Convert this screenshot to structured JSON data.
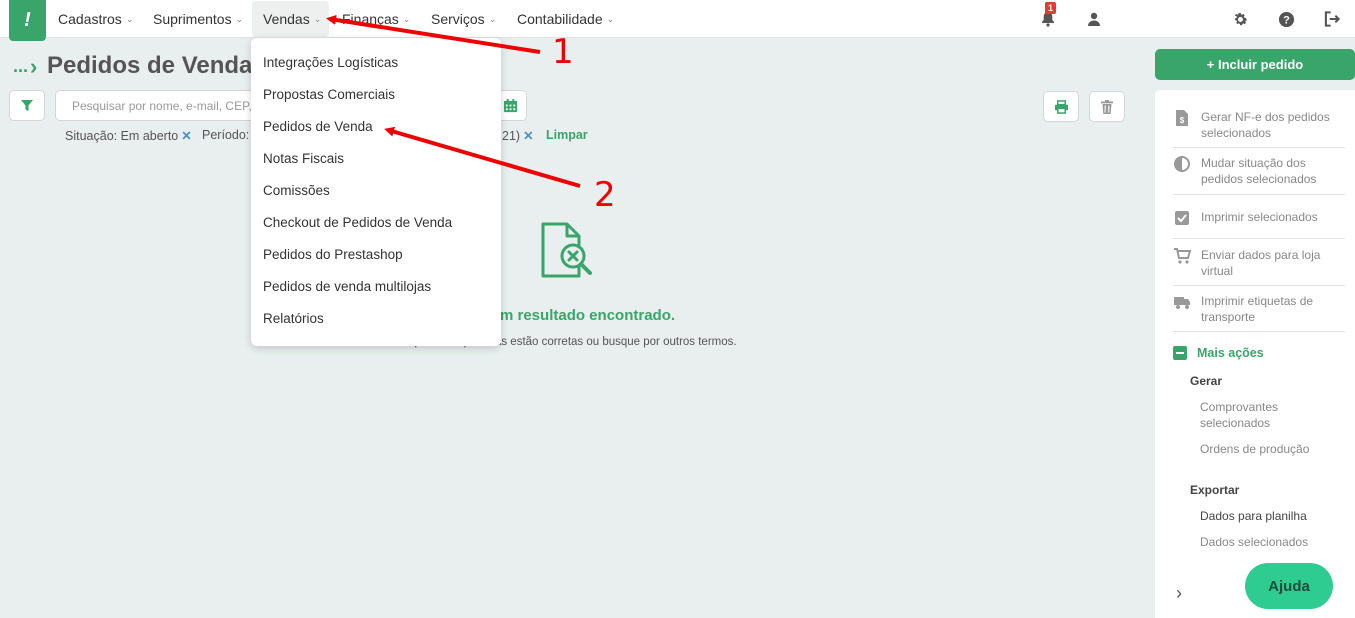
{
  "topbar": {
    "nav": [
      {
        "label": "Cadastros"
      },
      {
        "label": "Suprimentos"
      },
      {
        "label": "Vendas"
      },
      {
        "label": "Finanças"
      },
      {
        "label": "Serviços"
      },
      {
        "label": "Contabilidade"
      }
    ],
    "notification_count": "1",
    "icons": [
      "bell-icon",
      "user-icon",
      "gear-icon",
      "help-icon",
      "logout-icon"
    ]
  },
  "breadcrumb": {
    "ellipsis": "...",
    "title": "Pedidos de Venda"
  },
  "search": {
    "placeholder": "Pesquisar por nome, e-mail, CEP,"
  },
  "filters": {
    "situacao": "Situação: Em aberto",
    "periodo_label": "Período:",
    "periodo_tail": "21)",
    "clear": "Limpar"
  },
  "empty_state": {
    "title": "m resultado encontrado.",
    "subtitle": "Verifique se as palavras estão corretas ou busque por outros termos."
  },
  "dropdown": {
    "items": [
      "Integrações Logísticas",
      "Propostas Comerciais",
      "Pedidos de Venda",
      "Notas Fiscais",
      "Comissões",
      "Checkout de Pedidos de Venda",
      "Pedidos do Prestashop",
      "Pedidos de venda multilojas",
      "Relatórios"
    ]
  },
  "side": {
    "include_label": "+ Incluir pedido",
    "actions": [
      {
        "label": "Gerar NF-e dos pedidos selecionados",
        "icon": "invoice-icon"
      },
      {
        "label": "Mudar situação dos pedidos selecionados",
        "icon": "half-circle-icon"
      },
      {
        "label": "Imprimir selecionados",
        "icon": "checkbox-icon"
      },
      {
        "label": "Enviar dados para loja virtual",
        "icon": "cart-icon"
      },
      {
        "label": "Imprimir etiquetas de transporte",
        "icon": "truck-icon"
      }
    ],
    "more": "Mais ações",
    "gerar": {
      "heading": "Gerar",
      "items": [
        "Comprovantes selecionados",
        "Ordens de produção"
      ]
    },
    "exportar": {
      "heading": "Exportar",
      "items": [
        "Dados para planilha",
        "Dados selecionados"
      ]
    }
  },
  "help_label": "Ajuda",
  "annotations": {
    "label1": "1",
    "label2": "2",
    "color": "#ee0000"
  },
  "colors": {
    "brand": "#3aa56a",
    "help": "#2ecc91",
    "background": "#e8efee"
  }
}
